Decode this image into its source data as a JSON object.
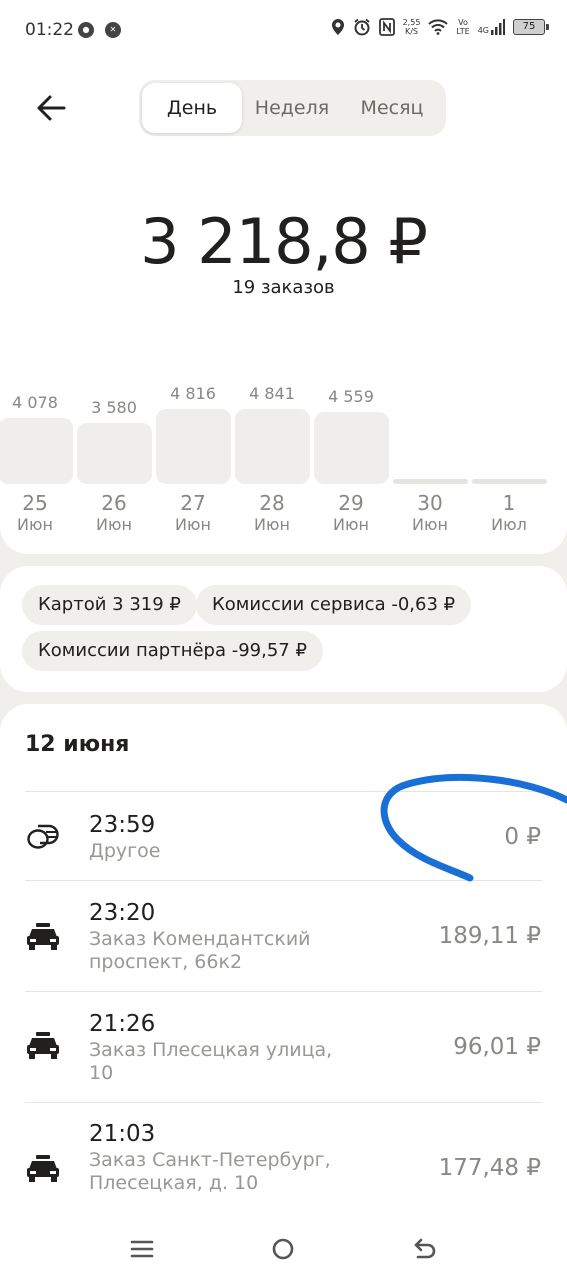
{
  "status_bar": {
    "time": "01:22",
    "left_icons": [
      "mir-icon",
      "app-icon"
    ],
    "net_speed_value": "2,55",
    "net_speed_unit": "K/S",
    "volte_top": "Vo",
    "volte_bottom": "LTE",
    "network": "4G",
    "battery": "75"
  },
  "header": {
    "tabs": [
      {
        "label": "День",
        "active": true
      },
      {
        "label": "Неделя",
        "active": false
      },
      {
        "label": "Месяц",
        "active": false
      }
    ]
  },
  "summary": {
    "total": "3 218,8 ₽",
    "orders": "19 заказов"
  },
  "chart_data": {
    "type": "bar",
    "categories": [
      "25 Июн",
      "26 Июн",
      "27 Июн",
      "28 Июн",
      "29 Июн",
      "30 Июн",
      "1 Июл"
    ],
    "days": [
      "25",
      "26",
      "27",
      "28",
      "29",
      "30",
      "1"
    ],
    "months": [
      "Июн",
      "Июн",
      "Июн",
      "Июн",
      "Июн",
      "Июн",
      "Июл"
    ],
    "values": [
      4078,
      3580,
      4816,
      4841,
      4559,
      0,
      0
    ],
    "value_labels": [
      "4 078",
      "3 580",
      "4 816",
      "4 841",
      "4 559",
      "",
      ""
    ],
    "title": "",
    "xlabel": "",
    "ylabel": "",
    "grid": false
  },
  "breakdown": {
    "card": "Картой 3 319 ₽",
    "service_fee": "Комиссии сервиса -0,63 ₽",
    "partner_fee": "Комиссии партнёра -99,57 ₽"
  },
  "orders_list": {
    "date": "12 июня",
    "items": [
      {
        "icon": "coins-icon",
        "time": "23:59",
        "desc": "Другое",
        "amount": "0 ₽"
      },
      {
        "icon": "taxi-icon",
        "time": "23:20",
        "desc": "Заказ Комендантский проспект, 66к2",
        "amount": "189,11 ₽"
      },
      {
        "icon": "taxi-icon",
        "time": "21:26",
        "desc": "Заказ Плесецкая улица, 10",
        "amount": "96,01 ₽"
      },
      {
        "icon": "taxi-icon",
        "time": "21:03",
        "desc": "Заказ Санкт-Петербург, Плесецкая, д. 10",
        "amount": "177,48 ₽"
      }
    ]
  },
  "colors": {
    "background": "#f1efec",
    "card": "#ffffff",
    "text": "#21201f",
    "muted": "#8a8784",
    "annotation": "#1a6fd6"
  },
  "nav_bar": {
    "icons": [
      "menu-icon",
      "home-icon",
      "back-nav-icon"
    ]
  }
}
